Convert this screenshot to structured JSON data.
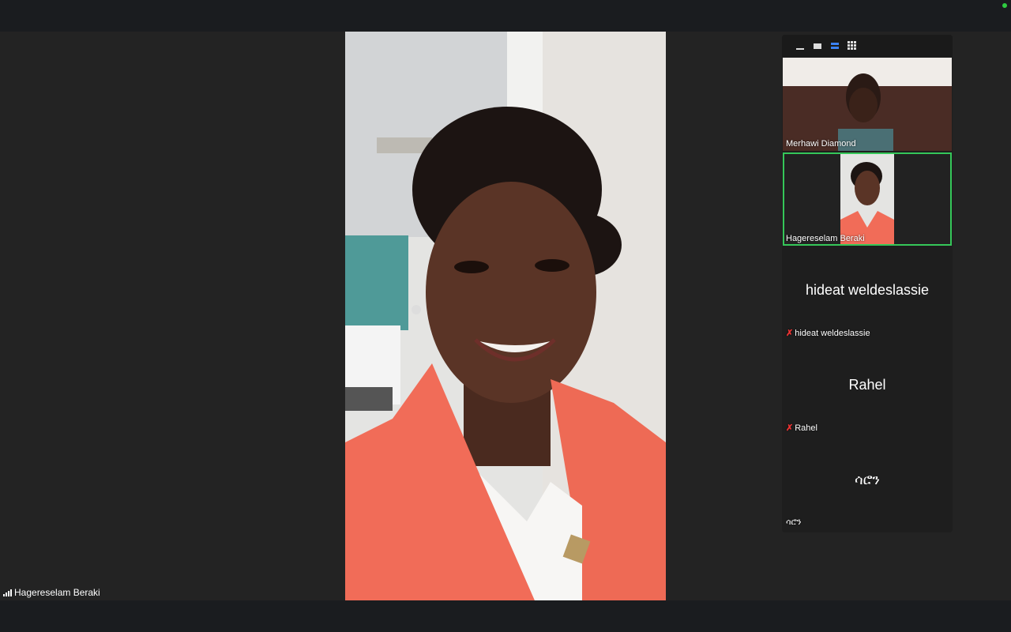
{
  "window": {
    "status_color": "#2ecc40"
  },
  "main_video": {
    "speaker_name": "Hagereselam Beraki",
    "signal_icon": "signal-bars-icon"
  },
  "view_toolbar": {
    "buttons": [
      {
        "icon": "minimize-view-icon"
      },
      {
        "icon": "single-video-icon"
      },
      {
        "icon": "stacked-view-icon",
        "active": true
      },
      {
        "icon": "gallery-grid-icon"
      }
    ],
    "active_color": "#3b82f6"
  },
  "participants": [
    {
      "name": "Merhawi Diamond",
      "has_video": true,
      "muted": false
    },
    {
      "name": "Hagereselam Beraki",
      "has_video": true,
      "muted": false,
      "active_speaker": true
    },
    {
      "name": "hideat weldeslassie",
      "display_name": "hideat weldeslassie",
      "has_video": false,
      "muted": true
    },
    {
      "name": "Rahel",
      "display_name": "Rahel",
      "has_video": false,
      "muted": true
    },
    {
      "name": "ሳሮን",
      "display_name": "ሳሮን",
      "has_video": false,
      "muted": false
    }
  ],
  "colors": {
    "active_speaker_border": "#35c759",
    "muted_icon": "#e33333"
  }
}
